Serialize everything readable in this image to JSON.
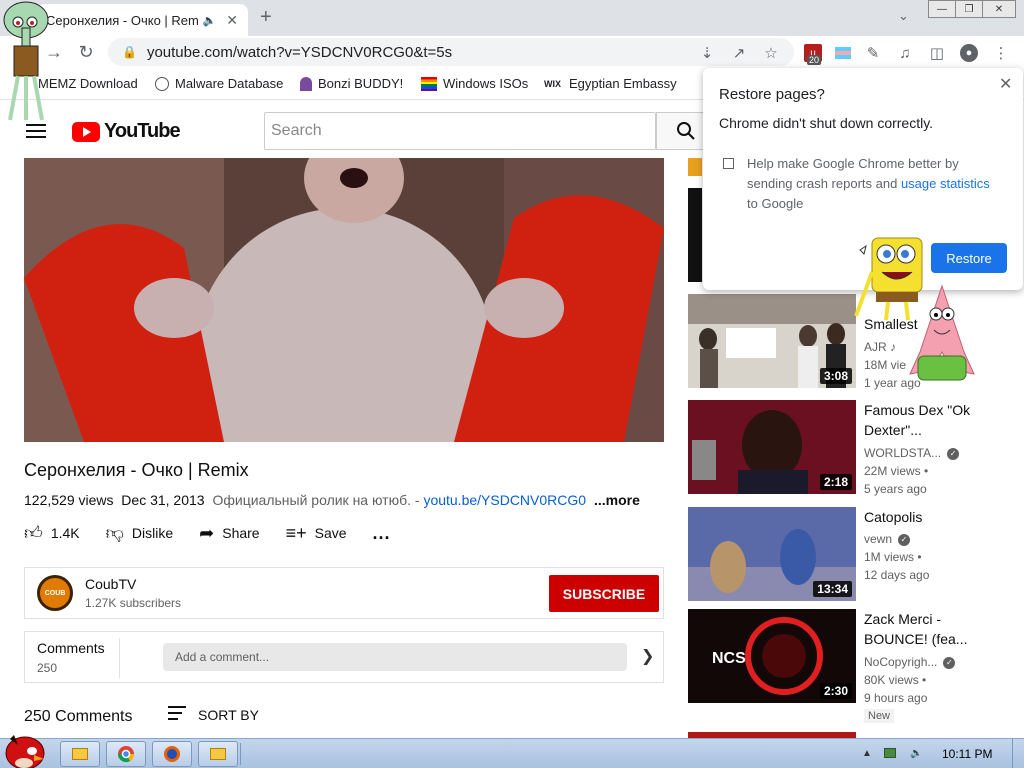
{
  "browser": {
    "tab_title": "Серонхелия - Очко | Remix",
    "url": "youtube.com/watch?v=YSDCNV0RCG0&t=5s",
    "extension_badge": "20"
  },
  "bookmarks": [
    {
      "label": "MEMZ Download"
    },
    {
      "label": "Malware Database"
    },
    {
      "label": "Bonzi BUDDY!"
    },
    {
      "label": "Windows ISOs"
    },
    {
      "label": "Egyptian Embassy",
      "icon_text": "WIX"
    }
  ],
  "youtube": {
    "logo_text": "YouTube",
    "search_placeholder": "Search"
  },
  "video": {
    "title": "Серонхелия - Очко | Remix",
    "views": "122,529 views",
    "date": "Dec 31, 2013",
    "description": "Официальный ролик на ютюб. - ",
    "desc_link": "youtu.be/YSDCNV0RCG0",
    "more": "...more"
  },
  "actions": {
    "like_count": "1.4K",
    "dislike": "Dislike",
    "share": "Share",
    "save": "Save",
    "more": "..."
  },
  "channel": {
    "name": "CoubTV",
    "subscribers": "1.27K subscribers",
    "avatar_text": "COUB",
    "subscribe": "SUBSCRIBE"
  },
  "comments": {
    "title": "Comments",
    "count": "250",
    "placeholder": "Add a comment...",
    "total": "250 Comments",
    "sort_by": "SORT BY"
  },
  "recommendations": [
    {
      "title": "Smallest",
      "channel": "AJR",
      "views": "18M vie",
      "ago": "1 year ago",
      "duration": "3:08"
    },
    {
      "title": "Famous Dex \"Ok Dexter\"...",
      "channel": "WORLDSTA...",
      "views": "22M views •",
      "ago": "5 years ago",
      "duration": "2:18"
    },
    {
      "title": "Catopolis",
      "channel": "vewn",
      "views": "1M views •",
      "ago": "12 days ago",
      "duration": "13:34"
    },
    {
      "title": "Zack Merci - BOUNCE! (fea...",
      "channel": "NoCopyrigh...",
      "views": "80K views •",
      "ago": "9 hours ago",
      "duration": "2:30",
      "badge": "New"
    }
  ],
  "popup": {
    "title": "Restore pages?",
    "message": "Chrome didn't shut down correctly.",
    "help_text": "Help make Google Chrome better by sending crash reports and ",
    "help_link": "usage statistics",
    "help_tail": " to Google",
    "restore_button": "Restore"
  },
  "taskbar": {
    "time": "10:11 PM"
  },
  "colors": {
    "youtube_red": "#ff0000",
    "subscribe_red": "#cc0000",
    "chrome_blue": "#1a73e8",
    "link_blue": "#065fd4"
  }
}
